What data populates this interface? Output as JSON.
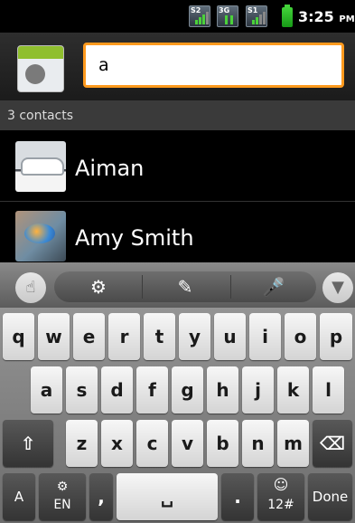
{
  "status_bar": {
    "icons": [
      {
        "name": "signal-icon",
        "tag": "S2"
      },
      {
        "name": "data-3g-icon",
        "tag": "3G"
      },
      {
        "name": "signal-sim-icon",
        "tag": "S1"
      }
    ],
    "time": "3:25",
    "ampm": "PM"
  },
  "search": {
    "query": "a"
  },
  "results": {
    "count_label": "3 contacts",
    "contacts": [
      {
        "name": "Aiman"
      },
      {
        "name": "Amy Smith"
      }
    ]
  },
  "keyboard": {
    "toolbar": {
      "hand_icon": "☝",
      "settings_icon": "⚙",
      "note_icon": "✎",
      "mic_icon": "🎤",
      "hide_icon": "▼"
    },
    "row1": [
      "q",
      "w",
      "e",
      "r",
      "t",
      "y",
      "u",
      "i",
      "o",
      "p"
    ],
    "row2": [
      "a",
      "s",
      "d",
      "f",
      "g",
      "h",
      "j",
      "k",
      "l"
    ],
    "row3": [
      "z",
      "x",
      "c",
      "v",
      "b",
      "n",
      "m"
    ],
    "shift_icon": "⇧",
    "backspace_icon": "⌫",
    "lang_icon": "A",
    "lang_settings_icon": "⚙",
    "lang_label": "EN",
    "comma": ",",
    "space_icon": "␣",
    "period": ".",
    "emoji_icon": "☺",
    "symbols_label": "12#",
    "done_label": "Done"
  }
}
